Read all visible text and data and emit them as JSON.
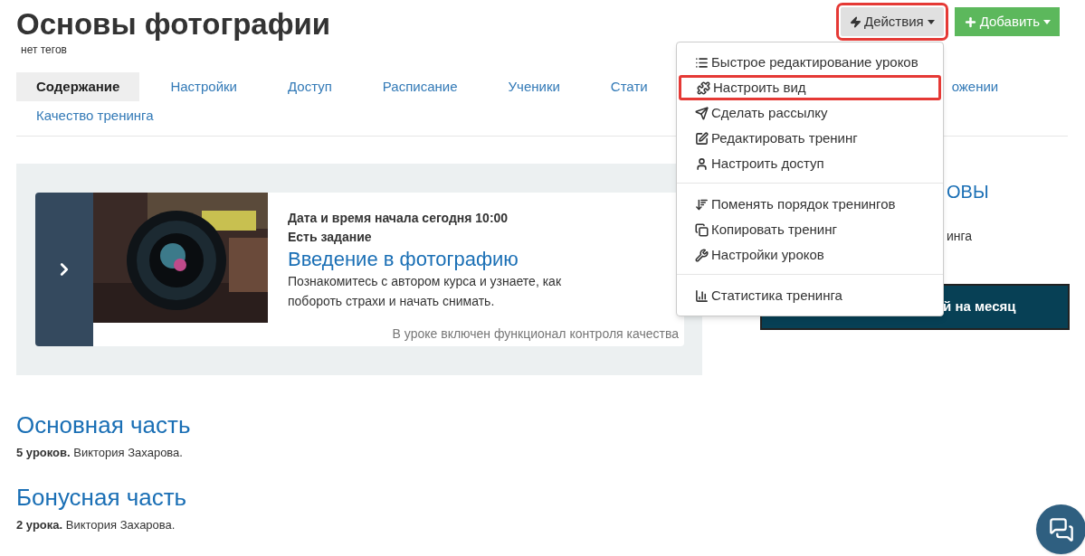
{
  "header": {
    "title": "Основы фотографии",
    "tags": "нет тегов"
  },
  "toolbar": {
    "buttons": [
      {
        "kind": "actions",
        "label": "Действия",
        "highlighted": true
      },
      {
        "kind": "add",
        "label": "Добавить",
        "highlighted": false
      }
    ]
  },
  "tabs": [
    {
      "label": "Содержание",
      "selected": true
    },
    {
      "label": "Настройки",
      "selected": false
    },
    {
      "label": "Доступ",
      "selected": false
    },
    {
      "label": "Расписание",
      "selected": false
    },
    {
      "label": "Ученики",
      "selected": false
    },
    {
      "label": "Стати",
      "selected": false
    },
    {
      "label": "ожении",
      "selected": false
    },
    {
      "label": "Качество тренинга",
      "selected": false
    }
  ],
  "actions_menu": {
    "groups": [
      [
        {
          "label": "Быстрое редактирование уроков",
          "highlighted": false
        },
        {
          "label": "Настроить вид",
          "highlighted": true
        },
        {
          "label": "Сделать рассылку",
          "highlighted": false
        },
        {
          "label": "Редактировать тренинг",
          "highlighted": false
        },
        {
          "label": "Настроить доступ",
          "highlighted": false
        }
      ],
      [
        {
          "label": "Поменять порядок тренингов",
          "highlighted": false
        },
        {
          "label": "Копировать тренинг",
          "highlighted": false
        },
        {
          "label": "Настройки уроков",
          "highlighted": false
        }
      ],
      [
        {
          "label": "Статистика тренинга",
          "highlighted": false
        }
      ]
    ]
  },
  "lesson": {
    "meta": [
      "Дата и время начала сегодня 10:00",
      "Есть задание"
    ],
    "title": "Введение в фотографию",
    "description": "Познакомитесь с автором курса и узнаете, как побороть страхи и начать снимать.",
    "footer": "В уроке включен функционал контроля качества"
  },
  "side": {
    "heading": "ОВЫ",
    "text": "инга",
    "button": "й на месяц"
  },
  "sections": [
    {
      "title": "Основная часть",
      "summary": "**5 уроков.** Виктория Захарова."
    },
    {
      "title": "Бонусная часть",
      "summary": "**2 урока.** Виктория Захарова."
    }
  ]
}
